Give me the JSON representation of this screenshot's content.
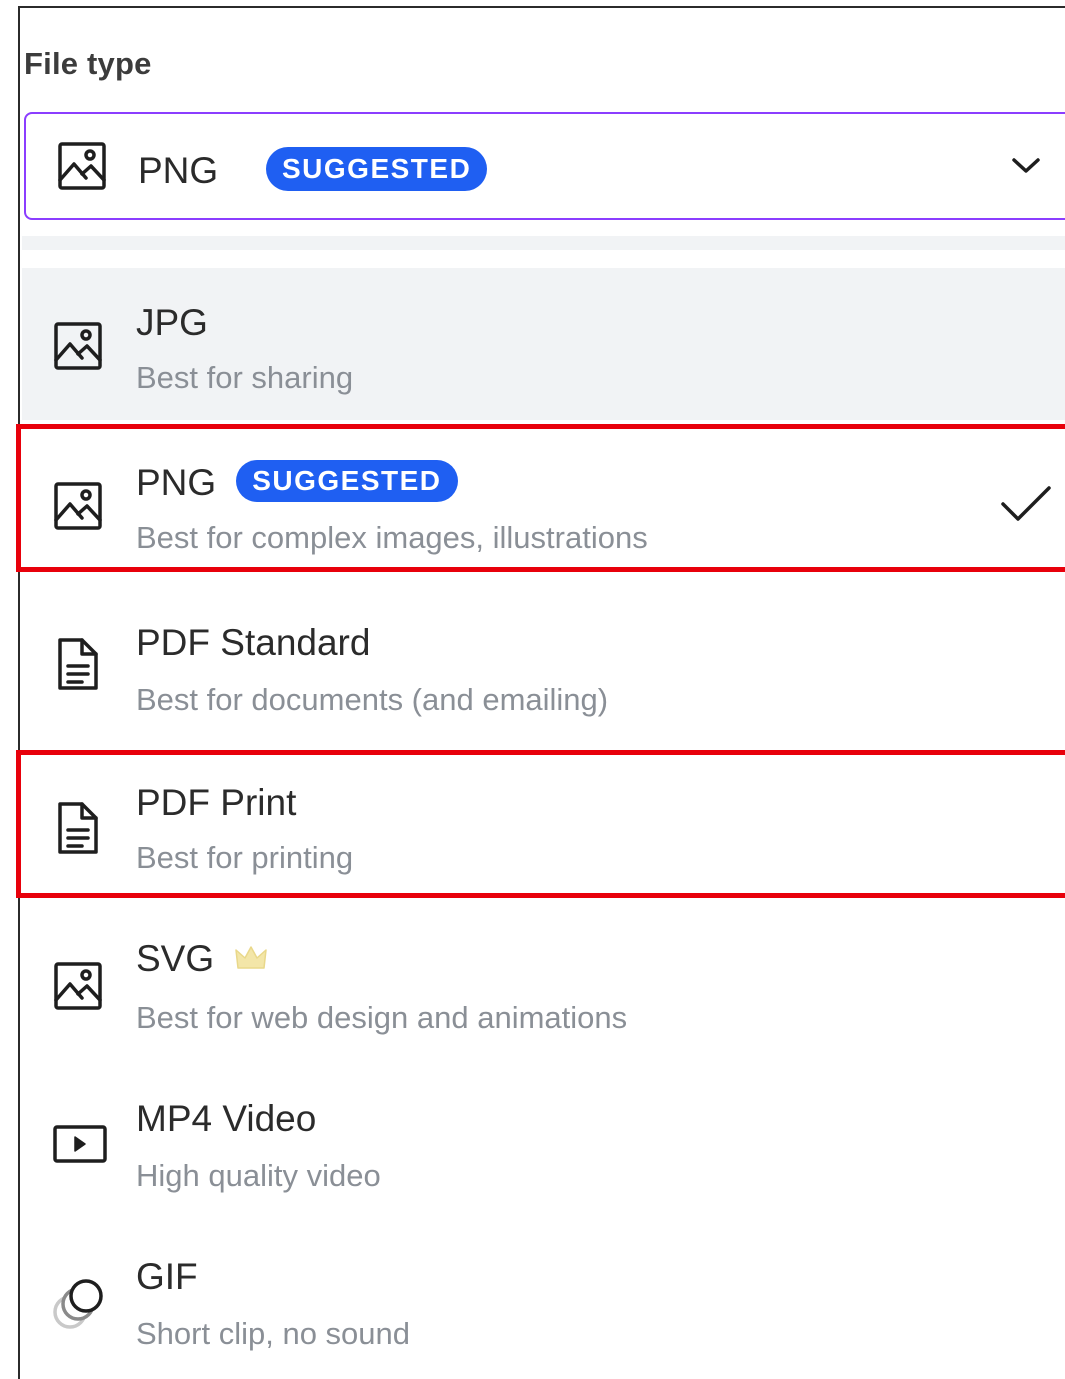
{
  "file_type": {
    "label": "File type",
    "selected": {
      "name": "PNG",
      "badge": "SUGGESTED",
      "icon": "image-icon"
    },
    "chevron_icon": "chevron-down-icon"
  },
  "options": [
    {
      "name": "JPG",
      "description": "Best for sharing",
      "icon": "image-icon",
      "hovered": true
    },
    {
      "name": "PNG",
      "badge": "SUGGESTED",
      "description": "Best for complex images, illustrations",
      "icon": "image-icon",
      "selected": true,
      "check_icon": "checkmark-icon"
    },
    {
      "name": "PDF Standard",
      "description": "Best for documents (and emailing)",
      "icon": "document-icon"
    },
    {
      "name": "PDF Print",
      "description": "Best for printing",
      "icon": "document-icon"
    },
    {
      "name": "SVG",
      "description": "Best for web design and animations",
      "icon": "image-icon",
      "pro_icon": "crown-icon"
    },
    {
      "name": "MP4 Video",
      "description": "High quality video",
      "icon": "video-play-icon"
    },
    {
      "name": "GIF",
      "description": "Short clip, no sound",
      "icon": "gif-icon"
    }
  ],
  "colors": {
    "accent": "#8b3dff",
    "badge": "#1f5ff2",
    "highlight": "#e8000b",
    "hover": "#f1f3f5"
  }
}
